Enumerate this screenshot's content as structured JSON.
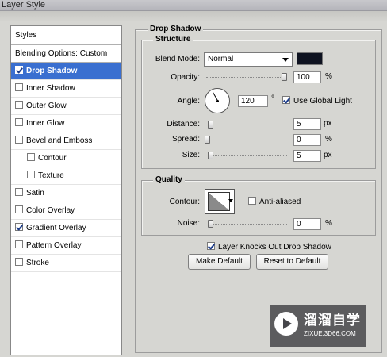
{
  "window": {
    "title": "Layer Style"
  },
  "styles_list": {
    "header": "Styles",
    "items": [
      {
        "label": "Blending Options: Custom",
        "has_checkbox": false,
        "checked": false,
        "selected": false,
        "sub": false
      },
      {
        "label": "Drop Shadow",
        "has_checkbox": true,
        "checked": true,
        "selected": true,
        "sub": false
      },
      {
        "label": "Inner Shadow",
        "has_checkbox": true,
        "checked": false,
        "selected": false,
        "sub": false
      },
      {
        "label": "Outer Glow",
        "has_checkbox": true,
        "checked": false,
        "selected": false,
        "sub": false
      },
      {
        "label": "Inner Glow",
        "has_checkbox": true,
        "checked": false,
        "selected": false,
        "sub": false
      },
      {
        "label": "Bevel and Emboss",
        "has_checkbox": true,
        "checked": false,
        "selected": false,
        "sub": false
      },
      {
        "label": "Contour",
        "has_checkbox": true,
        "checked": false,
        "selected": false,
        "sub": true
      },
      {
        "label": "Texture",
        "has_checkbox": true,
        "checked": false,
        "selected": false,
        "sub": true
      },
      {
        "label": "Satin",
        "has_checkbox": true,
        "checked": false,
        "selected": false,
        "sub": false
      },
      {
        "label": "Color Overlay",
        "has_checkbox": true,
        "checked": false,
        "selected": false,
        "sub": false
      },
      {
        "label": "Gradient Overlay",
        "has_checkbox": true,
        "checked": true,
        "selected": false,
        "sub": false
      },
      {
        "label": "Pattern Overlay",
        "has_checkbox": true,
        "checked": false,
        "selected": false,
        "sub": false
      },
      {
        "label": "Stroke",
        "has_checkbox": true,
        "checked": false,
        "selected": false,
        "sub": false
      }
    ]
  },
  "drop_shadow": {
    "title": "Drop Shadow",
    "structure": {
      "title": "Structure",
      "blend_mode_label": "Blend Mode:",
      "blend_mode_value": "Normal",
      "shadow_color": "#0e1220",
      "opacity_label": "Opacity:",
      "opacity_value": "100",
      "opacity_unit": "%",
      "angle_label": "Angle:",
      "angle_value": "120",
      "angle_unit": "°",
      "use_global_light_label": "Use Global Light",
      "use_global_light": true,
      "distance_label": "Distance:",
      "distance_value": "5",
      "distance_unit": "px",
      "spread_label": "Spread:",
      "spread_value": "0",
      "spread_unit": "%",
      "size_label": "Size:",
      "size_value": "5",
      "size_unit": "px"
    },
    "quality": {
      "title": "Quality",
      "contour_label": "Contour:",
      "anti_aliased_label": "Anti-aliased",
      "anti_aliased": false,
      "noise_label": "Noise:",
      "noise_value": "0",
      "noise_unit": "%"
    },
    "knockout_label": "Layer Knocks Out Drop Shadow",
    "knockout": true,
    "make_default_label": "Make Default",
    "reset_default_label": "Reset to Default"
  },
  "watermark": {
    "title": "溜溜自学",
    "subtitle": "ZIXUE.3D66.COM"
  }
}
